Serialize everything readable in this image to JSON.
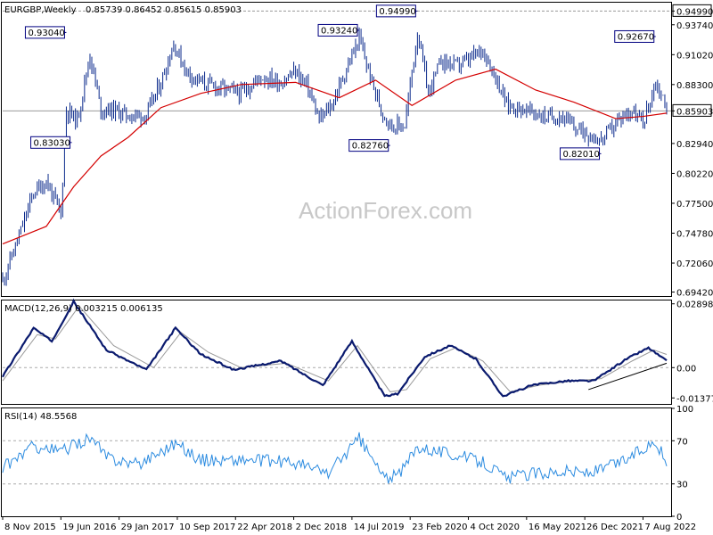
{
  "header": {
    "symbol_label": "EURGBP,Weekly",
    "ohlc_text": "0.85739 0.86452 0.85615 0.85903",
    "macd_label": "MACD(12,26,9) 0.003215 0.006135",
    "rsi_label": "RSI(14) 48.5568"
  },
  "watermark": "ActionForex.com",
  "colors": {
    "price_bar": "#0b2a8c",
    "moving_average": "#d40000",
    "macd_line": "#0a1a6e",
    "signal_line": "#9a9a9a",
    "rsi_line": "#2b8be0",
    "grid": "#aaaaaa",
    "box_border": "#000080"
  },
  "chart_data": [
    {
      "type": "ohlc",
      "panel": "price",
      "ylim": [
        0.6906,
        0.9575
      ],
      "yticks": [
        "0.94990",
        "0.93740",
        "0.91020",
        "0.88300",
        "0.85903",
        "0.82940",
        "0.80220",
        "0.77500",
        "0.74780",
        "0.72060",
        "0.69420"
      ],
      "highlighted_levels": [
        "0.94990",
        "0.85903"
      ],
      "annotations": [
        {
          "label": "0.93040",
          "x": "2016-07-10",
          "y": 0.9304
        },
        {
          "label": "0.83030",
          "x": "2016-07-31",
          "y": 0.8303
        },
        {
          "label": "0.93240",
          "x": "2019-08-11",
          "y": 0.9324
        },
        {
          "label": "0.82760",
          "x": "2019-12-08",
          "y": 0.8276
        },
        {
          "label": "0.94990",
          "x": "2020-03-22",
          "y": 0.9499
        },
        {
          "label": "0.82010",
          "x": "2022-02-27",
          "y": 0.8201
        },
        {
          "label": "0.92670",
          "x": "2022-09-25",
          "y": 0.9267
        }
      ],
      "series_keypoints": {
        "price": [
          [
            "2015-11-08",
            0.705
          ],
          [
            "2016-01-10",
            0.745
          ],
          [
            "2016-03-06",
            0.785
          ],
          [
            "2016-04-24",
            0.795
          ],
          [
            "2016-06-19",
            0.765
          ],
          [
            "2016-07-10",
            0.86
          ],
          [
            "2016-08-21",
            0.85
          ],
          [
            "2016-10-09",
            0.91
          ],
          [
            "2016-11-20",
            0.86
          ],
          [
            "2017-01-08",
            0.86
          ],
          [
            "2017-03-05",
            0.855
          ],
          [
            "2017-05-14",
            0.855
          ],
          [
            "2017-07-09",
            0.885
          ],
          [
            "2017-08-27",
            0.92
          ],
          [
            "2017-10-15",
            0.895
          ],
          [
            "2017-12-10",
            0.885
          ],
          [
            "2018-02-18",
            0.88
          ],
          [
            "2018-05-13",
            0.875
          ],
          [
            "2018-07-29",
            0.89
          ],
          [
            "2018-10-14",
            0.885
          ],
          [
            "2018-12-09",
            0.895
          ],
          [
            "2019-01-27",
            0.88
          ],
          [
            "2019-03-10",
            0.85
          ],
          [
            "2019-04-28",
            0.865
          ],
          [
            "2019-06-16",
            0.893
          ],
          [
            "2019-08-11",
            0.925
          ],
          [
            "2019-09-22",
            0.89
          ],
          [
            "2019-11-03",
            0.86
          ],
          [
            "2019-12-15",
            0.845
          ],
          [
            "2020-02-02",
            0.846
          ],
          [
            "2020-03-22",
            0.93
          ],
          [
            "2020-05-03",
            0.875
          ],
          [
            "2020-06-21",
            0.905
          ],
          [
            "2020-08-16",
            0.9
          ],
          [
            "2020-10-04",
            0.905
          ],
          [
            "2020-11-29",
            0.915
          ],
          [
            "2021-01-17",
            0.89
          ],
          [
            "2021-02-28",
            0.865
          ],
          [
            "2021-04-11",
            0.862
          ],
          [
            "2021-06-06",
            0.858
          ],
          [
            "2021-08-01",
            0.853
          ],
          [
            "2021-09-26",
            0.855
          ],
          [
            "2021-11-07",
            0.845
          ],
          [
            "2021-12-26",
            0.84
          ],
          [
            "2022-02-27",
            0.832
          ],
          [
            "2022-04-24",
            0.848
          ],
          [
            "2022-06-19",
            0.86
          ],
          [
            "2022-08-07",
            0.848
          ],
          [
            "2022-09-25",
            0.885
          ],
          [
            "2022-10-23",
            0.87
          ],
          [
            "2022-11-06",
            0.86
          ]
        ],
        "moving_average": [
          [
            "2015-11-08",
            0.738
          ],
          [
            "2016-04-24",
            0.754
          ],
          [
            "2016-08-07",
            0.79
          ],
          [
            "2016-11-20",
            0.818
          ],
          [
            "2017-03-05",
            0.835
          ],
          [
            "2017-07-09",
            0.862
          ],
          [
            "2017-12-10",
            0.875
          ],
          [
            "2018-05-13",
            0.883
          ],
          [
            "2018-12-09",
            0.885
          ],
          [
            "2019-05-26",
            0.871
          ],
          [
            "2019-10-13",
            0.887
          ],
          [
            "2020-03-01",
            0.864
          ],
          [
            "2020-08-16",
            0.887
          ],
          [
            "2021-01-17",
            0.897
          ],
          [
            "2021-06-20",
            0.878
          ],
          [
            "2021-11-14",
            0.867
          ],
          [
            "2022-04-24",
            0.852
          ],
          [
            "2022-08-07",
            0.854
          ],
          [
            "2022-11-06",
            0.857
          ]
        ]
      }
    },
    {
      "type": "line",
      "panel": "macd",
      "title": "MACD(12,26,9)",
      "ylim": [
        -0.0165,
        0.0305
      ],
      "yticks": [
        "0.028988",
        "0.00",
        "-0.013779"
      ],
      "series_keypoints": {
        "macd": [
          [
            "2015-11-08",
            -0.004
          ],
          [
            "2016-03-06",
            0.018
          ],
          [
            "2016-05-15",
            0.012
          ],
          [
            "2016-08-07",
            0.03
          ],
          [
            "2016-12-11",
            0.008
          ],
          [
            "2017-05-14",
            -0.001
          ],
          [
            "2017-09-03",
            0.018
          ],
          [
            "2017-12-10",
            0.006
          ],
          [
            "2018-04-15",
            -0.001
          ],
          [
            "2018-10-14",
            0.003
          ],
          [
            "2019-03-24",
            -0.008
          ],
          [
            "2019-07-14",
            0.012
          ],
          [
            "2019-11-17",
            -0.013
          ],
          [
            "2020-01-05",
            -0.012
          ],
          [
            "2020-04-19",
            0.005
          ],
          [
            "2020-07-26",
            0.01
          ],
          [
            "2020-11-01",
            0.004
          ],
          [
            "2021-02-14",
            -0.013
          ],
          [
            "2021-06-06",
            -0.008
          ],
          [
            "2021-10-17",
            -0.006
          ],
          [
            "2022-01-30",
            -0.006
          ],
          [
            "2022-06-05",
            0.004
          ],
          [
            "2022-08-28",
            0.009
          ],
          [
            "2022-11-06",
            0.003
          ]
        ],
        "signal": [
          [
            "2015-11-08",
            -0.006
          ],
          [
            "2016-03-20",
            0.015
          ],
          [
            "2016-05-29",
            0.013
          ],
          [
            "2016-08-28",
            0.028
          ],
          [
            "2017-01-08",
            0.01
          ],
          [
            "2017-06-11",
            0.0
          ],
          [
            "2017-09-24",
            0.016
          ],
          [
            "2018-01-07",
            0.007
          ],
          [
            "2018-05-13",
            0.0
          ],
          [
            "2018-11-04",
            0.002
          ],
          [
            "2019-04-14",
            -0.006
          ],
          [
            "2019-08-04",
            0.01
          ],
          [
            "2019-12-08",
            -0.011
          ],
          [
            "2020-02-09",
            -0.01
          ],
          [
            "2020-05-10",
            0.004
          ],
          [
            "2020-08-16",
            0.009
          ],
          [
            "2020-11-29",
            0.003
          ],
          [
            "2021-03-14",
            -0.011
          ],
          [
            "2021-07-04",
            -0.008
          ],
          [
            "2021-11-14",
            -0.006
          ],
          [
            "2022-02-27",
            -0.005
          ],
          [
            "2022-06-26",
            0.003
          ],
          [
            "2022-09-18",
            0.008
          ],
          [
            "2022-11-06",
            0.006
          ]
        ],
        "trendline": [
          [
            "2022-01-09",
            -0.01
          ],
          [
            "2022-11-06",
            0.002
          ]
        ]
      }
    },
    {
      "type": "line",
      "panel": "rsi",
      "title": "RSI(14)",
      "ylim": [
        0,
        100
      ],
      "yticks": [
        "100",
        "70",
        "30",
        "0"
      ],
      "reference_levels": [
        70,
        30
      ],
      "series_keypoints": {
        "rsi": [
          [
            "2015-11-08",
            45
          ],
          [
            "2016-03-06",
            65
          ],
          [
            "2016-06-19",
            60
          ],
          [
            "2016-10-09",
            73
          ],
          [
            "2016-12-11",
            55
          ],
          [
            "2017-04-09",
            48
          ],
          [
            "2017-09-03",
            68
          ],
          [
            "2017-12-10",
            52
          ],
          [
            "2018-06-10",
            52
          ],
          [
            "2018-11-25",
            50
          ],
          [
            "2019-04-14",
            40
          ],
          [
            "2019-08-11",
            72
          ],
          [
            "2019-11-17",
            35
          ],
          [
            "2020-01-12",
            38
          ],
          [
            "2020-03-22",
            65
          ],
          [
            "2020-07-26",
            58
          ],
          [
            "2020-12-06",
            50
          ],
          [
            "2021-02-28",
            35
          ],
          [
            "2021-06-13",
            40
          ],
          [
            "2021-10-17",
            42
          ],
          [
            "2022-01-23",
            40
          ],
          [
            "2022-05-29",
            52
          ],
          [
            "2022-09-25",
            70
          ],
          [
            "2022-11-06",
            48
          ]
        ]
      }
    }
  ],
  "x_axis": {
    "tick_labels": [
      {
        "label": "8 Nov 2015",
        "x": "2015-11-08"
      },
      {
        "label": "19 Jun 2016",
        "x": "2016-06-19"
      },
      {
        "label": "29 Jan 2017",
        "x": "2017-01-29"
      },
      {
        "label": "10 Sep 2017",
        "x": "2017-09-10"
      },
      {
        "label": "22 Apr 2018",
        "x": "2018-04-22"
      },
      {
        "label": "2 Dec 2018",
        "x": "2018-12-02"
      },
      {
        "label": "14 Jul 2019",
        "x": "2019-07-14"
      },
      {
        "label": "23 Feb 2020",
        "x": "2020-02-23"
      },
      {
        "label": "4 Oct 2020",
        "x": "2020-10-04"
      },
      {
        "label": "16 May 2021",
        "x": "2021-05-16"
      },
      {
        "label": "26 Dec 2021",
        "x": "2021-12-26"
      },
      {
        "label": "7 Aug 2022",
        "x": "2022-08-07"
      }
    ]
  }
}
